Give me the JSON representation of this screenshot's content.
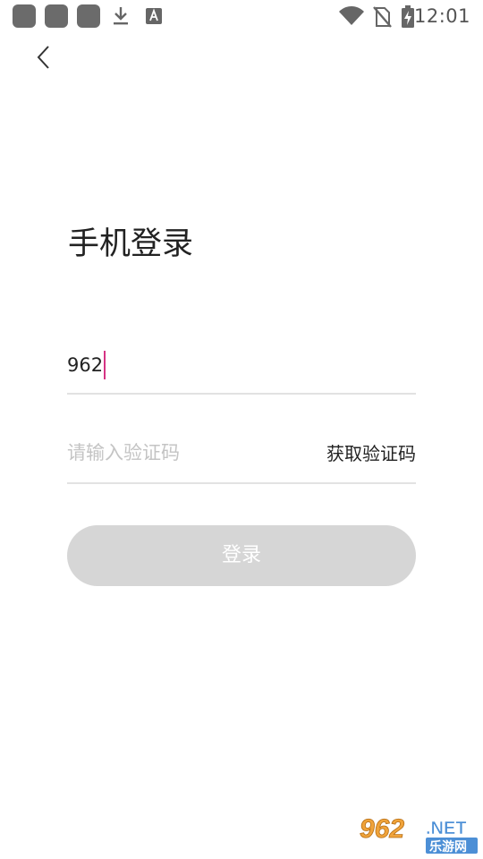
{
  "status_bar": {
    "time": "12:01",
    "icons": [
      "notification-square-icon",
      "notification-square-icon",
      "notification-square-icon",
      "download-icon",
      "a-font-icon",
      "wifi-icon",
      "no-sim-icon",
      "battery-charging-icon"
    ]
  },
  "header": {
    "back_icon": "chevron-left-icon"
  },
  "login": {
    "title": "手机登录",
    "phone_value": "962",
    "code_placeholder": "请输入验证码",
    "get_code_label": "获取验证码",
    "submit_label": "登录"
  },
  "watermark": {
    "brand_number": "962",
    "brand_suffix": ".NET",
    "brand_cn": "乐游网"
  },
  "colors": {
    "caret": "#d63384",
    "button_disabled": "#d6d6d6",
    "divider": "#e2e2e2",
    "placeholder": "#c4c4c4"
  }
}
